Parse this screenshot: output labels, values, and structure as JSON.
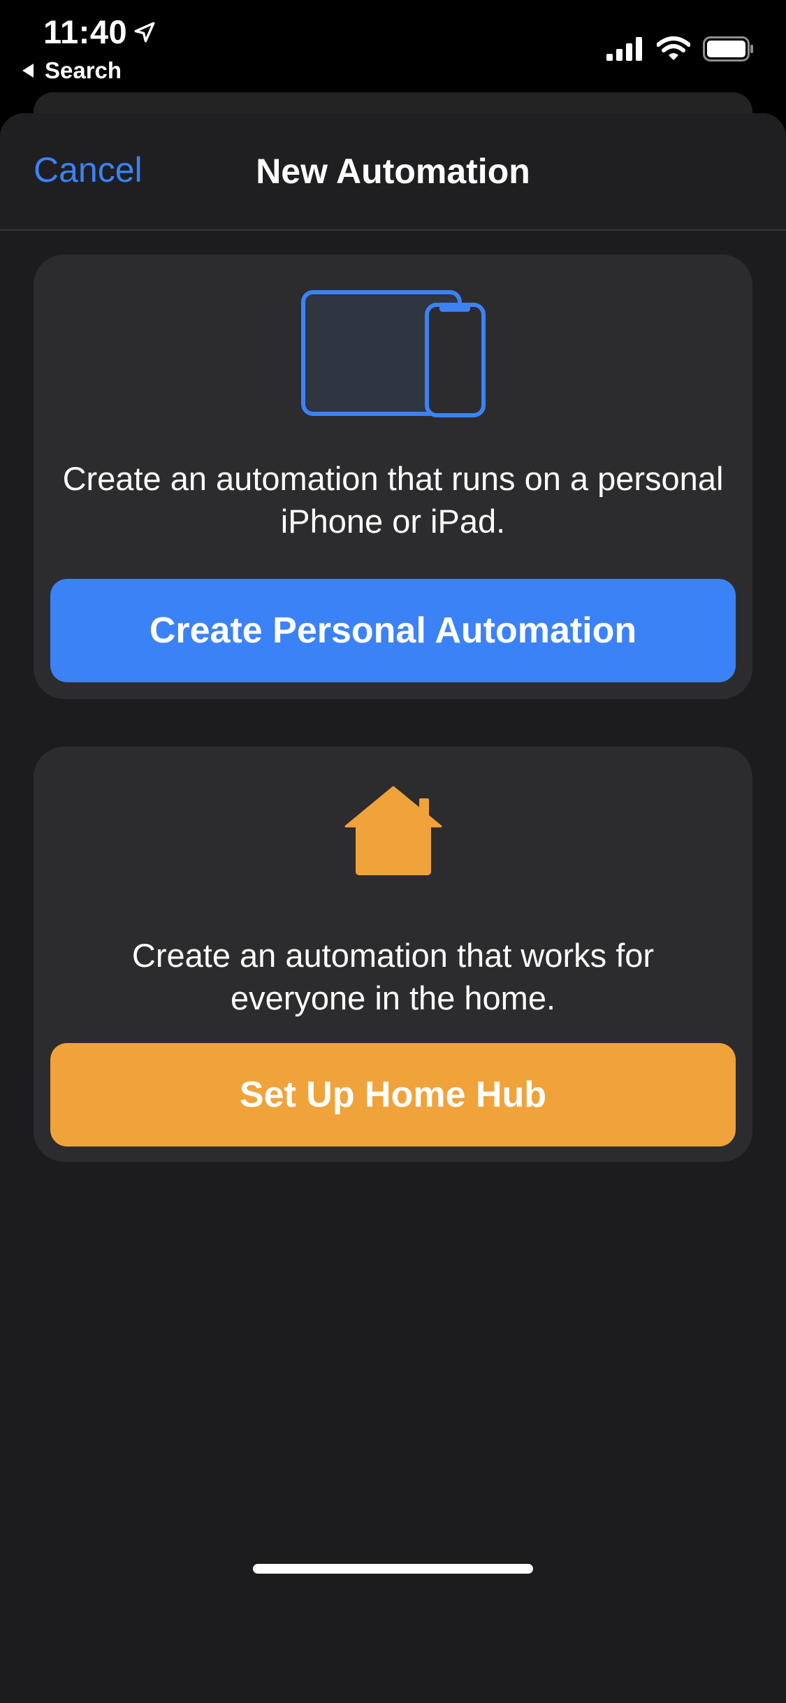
{
  "status_bar": {
    "time": "11:40",
    "back_label": "Search",
    "icons": [
      "location-arrow-icon",
      "cellular-signal-icon",
      "wifi-icon",
      "battery-icon"
    ]
  },
  "nav": {
    "cancel_label": "Cancel",
    "title": "New Automation"
  },
  "personal": {
    "icon": "ipad-iphone-icon",
    "description": "Create an automation that runs on a personal iPhone or iPad.",
    "button_label": "Create Personal Automation",
    "accent": "#3b82f6"
  },
  "home": {
    "icon": "home-icon",
    "description": "Create an automation that works for everyone in the home.",
    "button_label": "Set Up Home Hub",
    "accent": "#f0a33a"
  }
}
